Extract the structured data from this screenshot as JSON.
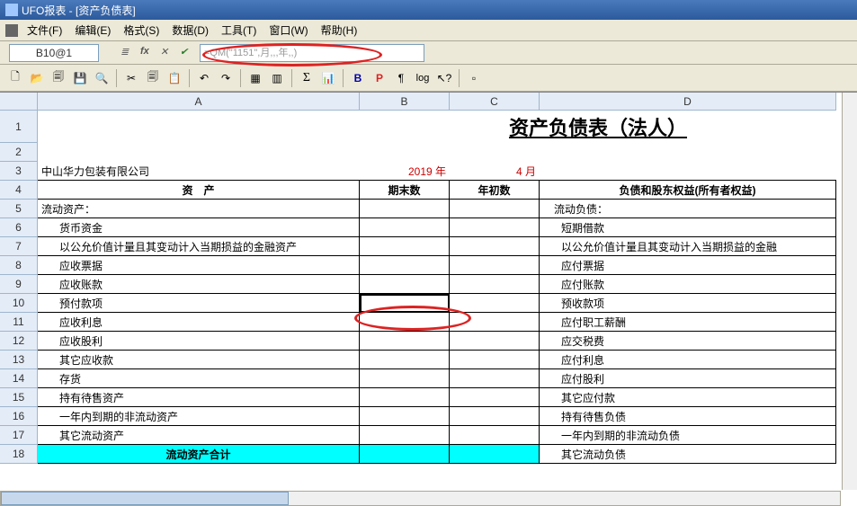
{
  "window": {
    "title": "UFO报表 - [资产负债表]"
  },
  "menu": {
    "file": "文件(F)",
    "edit": "编辑(E)",
    "format": "格式(S)",
    "data": "数据(D)",
    "tools": "工具(T)",
    "window": "窗口(W)",
    "help": "帮助(H)"
  },
  "formula": {
    "cellref": "B10@1",
    "value": "=QM(\"1151\",月,,,年,,)"
  },
  "cols": {
    "a": "A",
    "b": "B",
    "c": "C",
    "d": "D"
  },
  "sheet": {
    "title": "资产负债表（法人）",
    "company": "中山华力包装有限公司",
    "year": "2019 年",
    "month": "4 月",
    "hdr_asset": "资　产",
    "hdr_end": "期末数",
    "hdr_begin": "年初数",
    "hdr_liab": "负债和股东权益(所有者权益)",
    "r5a": "流动资产：",
    "r5d": "流动负债：",
    "r6a": "货币资金",
    "r6d": "短期借款",
    "r7a": "以公允价值计量且其变动计入当期损益的金融资产",
    "r7d": "以公允价值计量且其变动计入当期损益的金融",
    "r8a": "应收票据",
    "r8d": "应付票据",
    "r9a": "应收账款",
    "r9d": "应付账款",
    "r10a": "预付款项",
    "r10d": "预收款项",
    "r11a": "应收利息",
    "r11d": "应付职工薪酬",
    "r12a": "应收股利",
    "r12d": "应交税费",
    "r13a": "其它应收款",
    "r13d": "应付利息",
    "r14a": "存货",
    "r14d": "应付股利",
    "r15a": "持有待售资产",
    "r15d": "其它应付款",
    "r16a": "一年内到期的非流动资产",
    "r16d": "持有待售负债",
    "r17a": "其它流动资产",
    "r17d": "一年内到期的非流动负债",
    "r18a": "流动资产合计",
    "r18d": "其它流动负债"
  },
  "chart_data": {
    "type": "table",
    "title": "资产负债表（法人）",
    "company": "中山华力包装有限公司",
    "period": {
      "year": 2019,
      "month": 4
    },
    "columns": [
      "资产",
      "期末数",
      "年初数",
      "负债和股东权益(所有者权益)"
    ],
    "rows": [
      [
        "流动资产：",
        null,
        null,
        "流动负债："
      ],
      [
        "货币资金",
        null,
        null,
        "短期借款"
      ],
      [
        "以公允价值计量且其变动计入当期损益的金融资产",
        null,
        null,
        "以公允价值计量且其变动计入当期损益的金融"
      ],
      [
        "应收票据",
        null,
        null,
        "应付票据"
      ],
      [
        "应收账款",
        null,
        null,
        "应付账款"
      ],
      [
        "预付款项",
        null,
        null,
        "预收款项"
      ],
      [
        "应收利息",
        null,
        null,
        "应付职工薪酬"
      ],
      [
        "应收股利",
        null,
        null,
        "应交税费"
      ],
      [
        "其它应收款",
        null,
        null,
        "应付利息"
      ],
      [
        "存货",
        null,
        null,
        "应付股利"
      ],
      [
        "持有待售资产",
        null,
        null,
        "其它应付款"
      ],
      [
        "一年内到期的非流动资产",
        null,
        null,
        "持有待售负债"
      ],
      [
        "其它流动资产",
        null,
        null,
        "一年内到期的非流动负债"
      ],
      [
        "流动资产合计",
        null,
        null,
        "其它流动负债"
      ]
    ],
    "selected_cell": "B10",
    "selected_formula": "=QM(\"1151\",月,,,年,,)"
  }
}
